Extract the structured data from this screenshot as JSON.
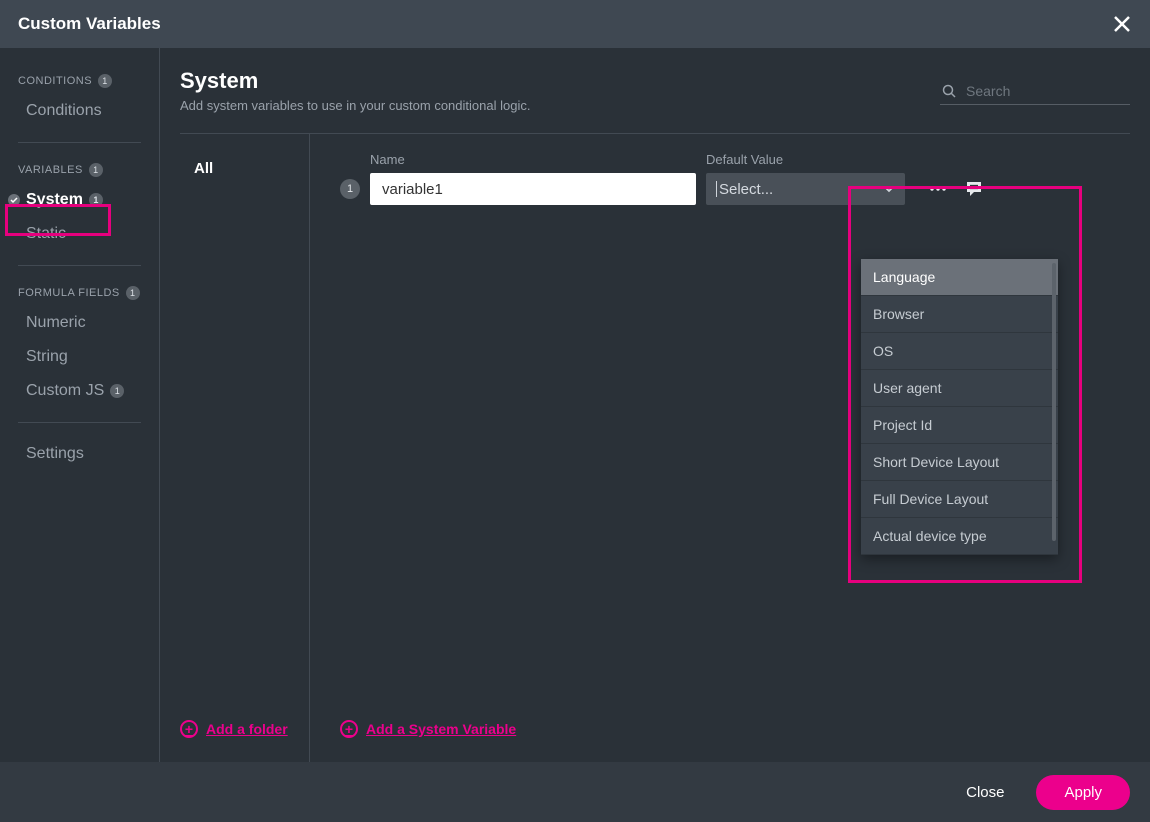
{
  "modal_title": "Custom Variables",
  "sidebar": {
    "sections": [
      {
        "label": "CONDITIONS",
        "count": "1",
        "items": [
          {
            "label": "Conditions"
          }
        ]
      },
      {
        "label": "VARIABLES",
        "count": "1",
        "items": [
          {
            "label": "System",
            "active": true,
            "checked": true,
            "count": "1"
          },
          {
            "label": "Static"
          }
        ]
      },
      {
        "label": "FORMULA FIELDS",
        "count": "1",
        "items": [
          {
            "label": "Numeric"
          },
          {
            "label": "String"
          },
          {
            "label": "Custom JS",
            "count": "1"
          }
        ]
      }
    ],
    "settings_label": "Settings"
  },
  "main": {
    "title": "System",
    "subtitle": "Add system variables to use in your custom conditional logic.",
    "search_placeholder": "Search",
    "folders": {
      "all_label": "All",
      "add_folder_label": "Add a folder"
    },
    "labels": {
      "name": "Name",
      "default_value": "Default Value"
    },
    "variable": {
      "index": "1",
      "name_value": "variable1",
      "select_placeholder": "Select..."
    },
    "add_variable_label": "Add a System Variable",
    "dropdown_options": [
      "Language",
      "Browser",
      "OS",
      "User agent",
      "Project Id",
      "Short Device Layout",
      "Full Device Layout",
      "Actual device type"
    ]
  },
  "footer": {
    "close": "Close",
    "apply": "Apply"
  }
}
